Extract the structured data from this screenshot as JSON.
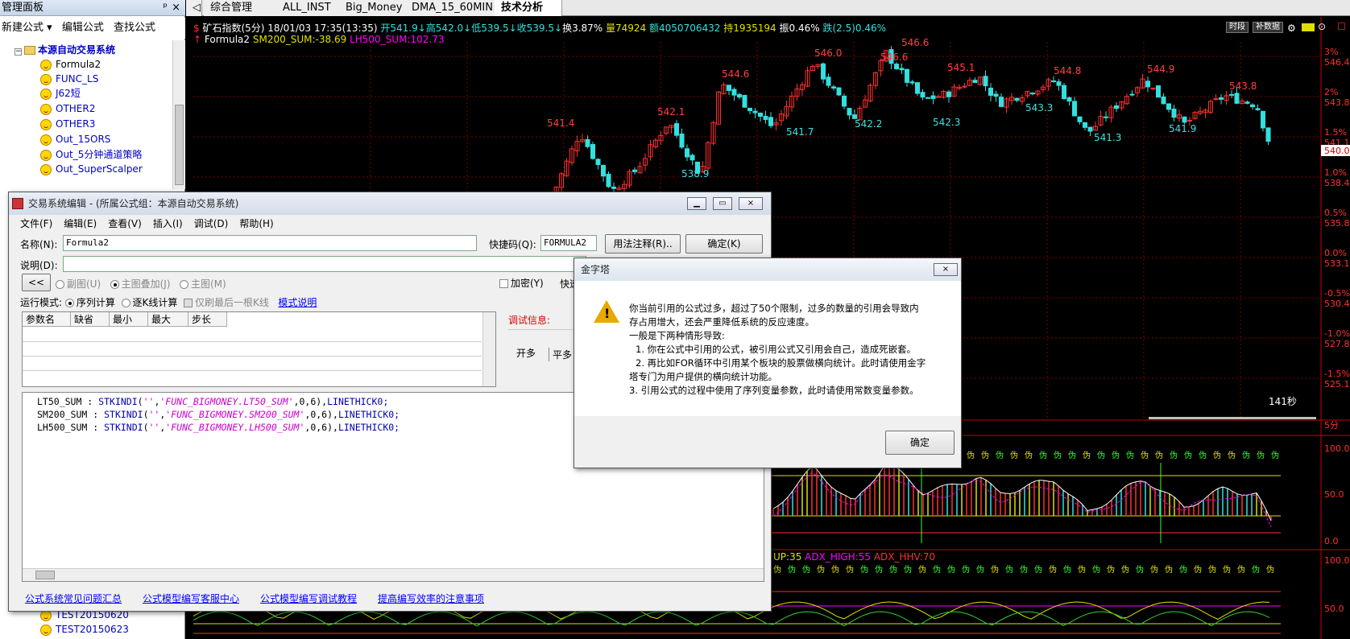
{
  "left_panel": {
    "title": "管理面板",
    "pin": "ᵖ",
    "close": "×",
    "toolbar": [
      "新建公式 ▾",
      "编辑公式",
      "查找公式"
    ],
    "root": "本源自动交易系统",
    "items": [
      "Formula2",
      "FUNC_LS",
      "J62短",
      "OTHER2",
      "OTHER3",
      "Out_15ORS",
      "Out_5分钟通道策略",
      "Out_SuperScalper"
    ],
    "bottom_items": [
      "TEST20150620",
      "TEST20150623"
    ]
  },
  "tabs": [
    "◁",
    "综合管理",
    "ALL_INST",
    "Big_Money",
    "DMA_15_60MIN",
    "技术分析"
  ],
  "quote": {
    "name": "矿石指数(5分)",
    "date": "18/01/03 17:35(13:35)",
    "open": "开541.9↓",
    "high": "高542.0↓",
    "low": "低539.5↓",
    "close": "收539.5↓",
    "turnover": "换3.87%",
    "vol": "量74924",
    "amount": "额4050706432",
    "hold": "持1935194",
    "amp": "振0.46%",
    "change": "跌(2.5)0.46%"
  },
  "formula_line": {
    "name": "Formula2",
    "sm": "SM200_SUM:-38.69",
    "lh": "LH500_SUM:102.73"
  },
  "chart_buttons": [
    "时段",
    "补数据"
  ],
  "price_axis": [
    {
      "p": "3%",
      "v": "546.4"
    },
    {
      "p": "2%",
      "v": "543.8"
    },
    {
      "p": "1.5%",
      "v": "541.1"
    },
    {
      "p": "1.0%",
      "v": "538.4"
    },
    {
      "p": "0.5%",
      "v": "535.8"
    },
    {
      "p": "0.0%",
      "v": "533.1"
    },
    {
      "p": "-0.5%",
      "v": "530.4"
    },
    {
      "p": "-1.0%",
      "v": "527.8"
    },
    {
      "p": "-1.5%",
      "v": "525.1"
    }
  ],
  "current_price": "540.0",
  "peak_labels_red": [
    "541.4",
    "542.1",
    "544.6",
    "546.0",
    "546.6",
    "546.6",
    "545.1",
    "544.8",
    "544.9",
    "543.8"
  ],
  "trough_labels_cyan": [
    "538.9",
    "541.7",
    "542.2",
    "542.3",
    "543.3",
    "541.3",
    "541.9"
  ],
  "timer": "141秒",
  "sub_axis1": [
    "5分",
    "100.0",
    "50.0",
    "0.0"
  ],
  "sub_axis2": [
    "100.0",
    "50.0"
  ],
  "adx_label": {
    "up": "UP:35",
    "high": "ADX_HIGH:55",
    "hhv": "ADX_HHV:70"
  },
  "editor": {
    "title": "交易系统编辑 - (所属公式组：本源自动交易系统)",
    "menu": [
      "文件(F)",
      "编辑(E)",
      "查看(V)",
      "插入(I)",
      "调试(D)",
      "帮助(H)"
    ],
    "name_label": "名称(N):",
    "name_value": "Formula2",
    "code_label": "快捷码(Q):",
    "code_value": "FORMULA2",
    "usage_btn": "用法注释(R)..",
    "ok_btn": "确定(K)",
    "desc_label": "说明(D):",
    "collapse": "<<",
    "radios": [
      "副图(U)",
      "主图叠加(J)",
      "主图(M)"
    ],
    "encrypt": "加密(Y)",
    "quick": "快速",
    "run_mode": "运行模式:",
    "mode1": "序列计算",
    "mode2": "逐K线计算",
    "mode3": "仅刷最后一根K线",
    "mode_link": "模式说明",
    "param_headers": [
      "参数名",
      "缺省",
      "最小",
      "最大",
      "步长"
    ],
    "debug": "调试信息:",
    "trade_tabs": [
      "开多",
      "平多"
    ],
    "code": [
      "LT50_SUM : STKINDI('','FUNC_BIGMONEY.LT50_SUM',0,6),LINETHICK0;",
      "SM200_SUM : STKINDI('','FUNC_BIGMONEY.SM200_SUM',0,6),LINETHICK0;",
      "LH500_SUM : STKINDI('','FUNC_BIGMONEY.LH500_SUM',0,6),LINETHICK0;"
    ],
    "links": [
      "公式系统常见问题汇总",
      "公式模型编写客服中心",
      "公式模型编写调试教程",
      "提高编写效率的注意事项"
    ]
  },
  "alert": {
    "title": "金字塔",
    "close": "×",
    "lines": [
      "你当前引用的公式过多，超过了50个限制，过多的数量的引用会导致内",
      "存占用增大，还会严重降低系统的反应速度。",
      "一般是下两种情形导致:",
      "1. 你在公式中引用的公式，被引用公式又引用会自己，造成死嵌套。",
      "2. 再比如FOR循环中引用某个板块的股票做横向统计。此时请使用金字",
      "塔专门为用户提供的横向统计功能。",
      "3. 引用公式的过程中使用了序列变量参数，此时请使用常数变量参数。"
    ],
    "ok": "确定"
  },
  "colors": {
    "up": "#ff3030",
    "down": "#33e0e0",
    "label_red": "#ff4040",
    "label_cyan": "#40e0e0",
    "grid": "#800000"
  }
}
